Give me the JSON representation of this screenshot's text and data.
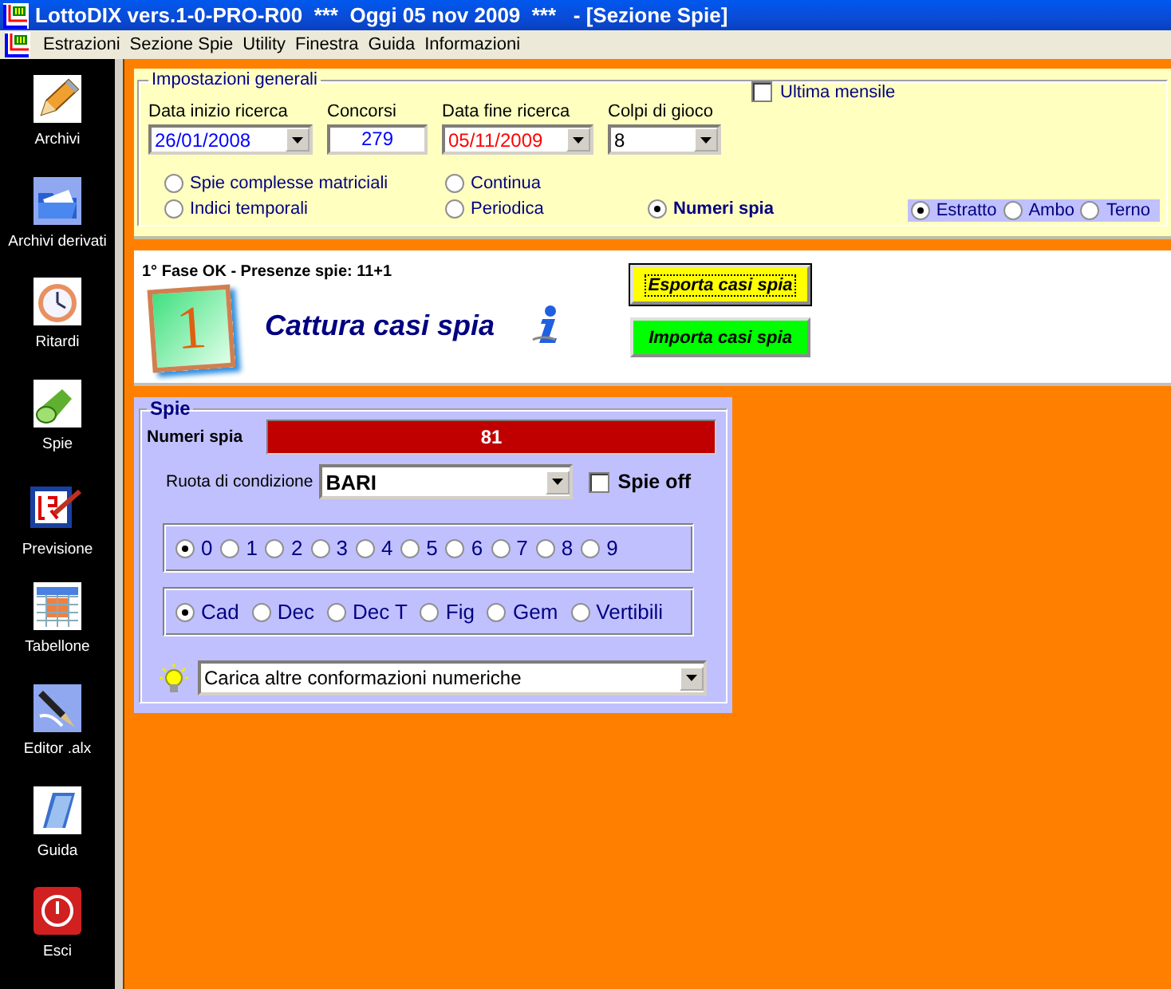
{
  "window": {
    "title": "LottoDIX vers.1-0-PRO-R00  ***  Oggi 05 nov 2009  ***   - [Sezione Spie]"
  },
  "menu": [
    "Estrazioni",
    "Sezione Spie",
    "Utility",
    "Finestra",
    "Guida",
    "Informazioni"
  ],
  "sidebar": {
    "items": [
      {
        "label": "Archivi",
        "kind": "pencil"
      },
      {
        "label": "Archivi derivati",
        "kind": "folder"
      },
      {
        "label": "Ritardi",
        "kind": "clock"
      },
      {
        "label": "Spie",
        "kind": "flashlight"
      },
      {
        "label": "Previsione",
        "kind": "chart"
      },
      {
        "label": "Tabellone",
        "kind": "grid"
      },
      {
        "label": "Editor .alx",
        "kind": "pen"
      },
      {
        "label": "Guida",
        "kind": "book"
      },
      {
        "label": "Esci",
        "kind": "power"
      }
    ]
  },
  "settings": {
    "legend": "Impostazioni generali",
    "fields": [
      {
        "label": "Data inizio ricerca",
        "value": "26/01/2008",
        "kind": "combo",
        "color": "#0000ff"
      },
      {
        "label": "Concorsi",
        "value": "279",
        "kind": "text",
        "color": "#0000ff"
      },
      {
        "label": "Data fine ricerca",
        "value": "05/11/2009",
        "kind": "combo",
        "color": "#ff0000"
      },
      {
        "label": "Colpi di gioco",
        "value": "8",
        "kind": "combo",
        "color": "#000000"
      }
    ],
    "last_monthly": {
      "label": "Ultima mensile",
      "checked": false
    },
    "modes": [
      {
        "label": "Spie complesse matriciali",
        "selected": false
      },
      {
        "label": "Indici temporali",
        "selected": false
      },
      {
        "label": "Continua",
        "selected": false
      },
      {
        "label": "Periodica",
        "selected": false
      },
      {
        "label": "Numeri spia",
        "selected": true
      }
    ],
    "bet_types": [
      {
        "label": "Estratto",
        "selected": true
      },
      {
        "label": "Ambo",
        "selected": false
      },
      {
        "label": "Terno",
        "selected": false
      }
    ]
  },
  "result": {
    "status": "1° Fase OK - Presenze spie: 11+1",
    "step_badge": "1",
    "title": "Cattura casi spia",
    "buttons": [
      {
        "label": "Esporta casi spia",
        "color": "#ffff00",
        "focused": true
      },
      {
        "label": "Importa casi spia",
        "color": "#00ff00",
        "focused": false
      }
    ]
  },
  "spie": {
    "legend": "Spie",
    "numbers_label": "Numeri spia",
    "numbers_value": "81",
    "wheel_label": "Ruota di condizione",
    "wheel_value": "BARI",
    "spie_off": {
      "label": "Spie off",
      "checked": false
    },
    "digits": [
      {
        "label": "0",
        "selected": true
      },
      {
        "label": "1",
        "selected": false
      },
      {
        "label": "2",
        "selected": false
      },
      {
        "label": "3",
        "selected": false
      },
      {
        "label": "4",
        "selected": false
      },
      {
        "label": "5",
        "selected": false
      },
      {
        "label": "6",
        "selected": false
      },
      {
        "label": "7",
        "selected": false
      },
      {
        "label": "8",
        "selected": false
      },
      {
        "label": "9",
        "selected": false
      }
    ],
    "types": [
      {
        "label": "Cad",
        "selected": true
      },
      {
        "label": "Dec",
        "selected": false
      },
      {
        "label": "Dec T",
        "selected": false
      },
      {
        "label": "Fig",
        "selected": false
      },
      {
        "label": "Gem",
        "selected": false
      },
      {
        "label": "Vertibili",
        "selected": false
      }
    ],
    "conformations": "Carica altre conformazioni numeriche"
  }
}
